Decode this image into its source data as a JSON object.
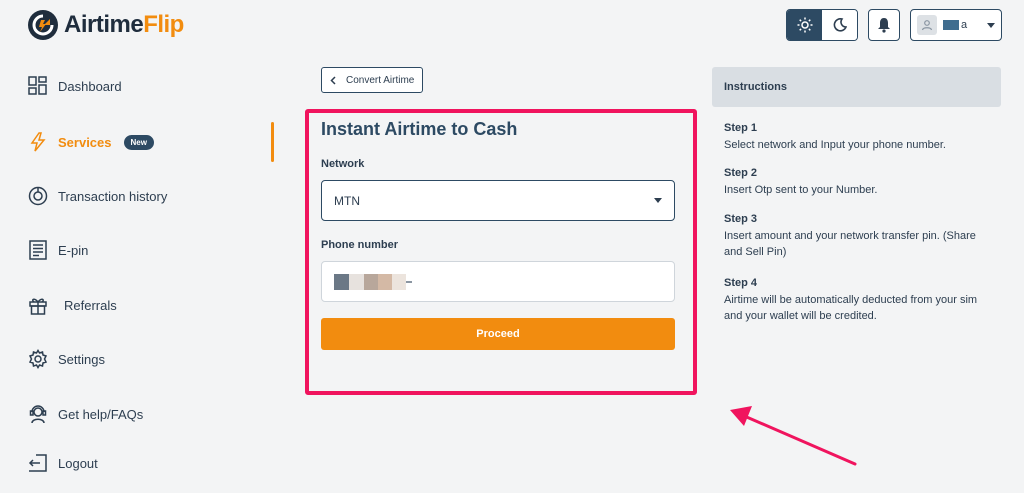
{
  "brand": {
    "name_part1": "Airtime",
    "name_part2": "Flip"
  },
  "header": {
    "user_name_suffix": "a"
  },
  "sidebar": {
    "items": [
      {
        "label": "Dashboard",
        "icon": "dashboard-icon"
      },
      {
        "label": "Services",
        "icon": "lightning-icon",
        "badge": "New",
        "active": true
      },
      {
        "label": "Transaction history",
        "icon": "history-icon"
      },
      {
        "label": "E-pin",
        "icon": "receipt-icon"
      },
      {
        "label": "Referrals",
        "icon": "gift-icon"
      },
      {
        "label": "Settings",
        "icon": "gear-icon"
      },
      {
        "label": "Get help/FAQs",
        "icon": "support-icon"
      },
      {
        "label": "Logout",
        "icon": "logout-icon"
      }
    ]
  },
  "breadcrumb": {
    "label": "Convert Airtime"
  },
  "form": {
    "title": "Instant Airtime to Cash",
    "network_label": "Network",
    "network_value": "MTN",
    "phone_label": "Phone number",
    "proceed_label": "Proceed"
  },
  "instructions": {
    "title": "Instructions",
    "steps": [
      {
        "title": "Step 1",
        "text": "Select network and Input your phone number."
      },
      {
        "title": "Step 2",
        "text": "Insert Otp sent to your Number."
      },
      {
        "title": "Step 3",
        "text": "Insert amount and your network transfer pin. (Share and Sell Pin)"
      },
      {
        "title": "Step 4",
        "text": "Airtime will be automatically deducted from your sim and your wallet will be credited."
      }
    ]
  },
  "colors": {
    "accent": "#f28c0f",
    "primary": "#2d4a63",
    "highlight": "#f0145e"
  }
}
